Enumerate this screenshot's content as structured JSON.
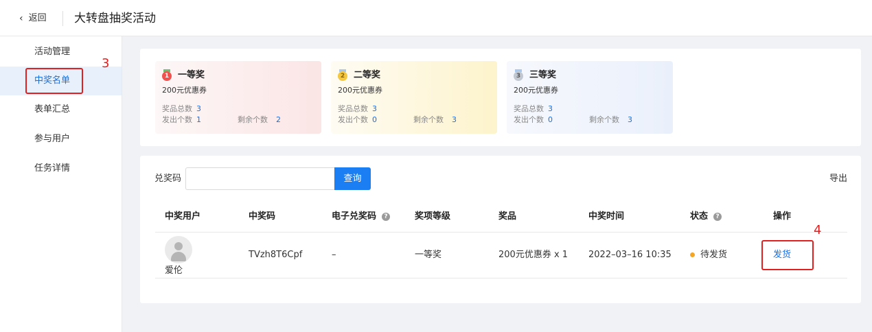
{
  "header": {
    "back_label": "返回",
    "title": "大转盘抽奖活动"
  },
  "sidebar": {
    "items": [
      {
        "label": "活动管理",
        "active": false
      },
      {
        "label": "中奖名单",
        "active": true
      },
      {
        "label": "表单汇总",
        "active": false
      },
      {
        "label": "参与用户",
        "active": false
      },
      {
        "label": "任务详情",
        "active": false
      }
    ]
  },
  "annotations": {
    "step_sidebar": "3",
    "step_action": "4"
  },
  "prizes": [
    {
      "rank": "1",
      "name": "一等奖",
      "desc": "200元优惠券",
      "total_label": "奖品总数",
      "total": "3",
      "issued_label": "发出个数",
      "issued": "1",
      "remaining_label": "剩余个数",
      "remaining": "2"
    },
    {
      "rank": "2",
      "name": "二等奖",
      "desc": "200元优惠券",
      "total_label": "奖品总数",
      "total": "3",
      "issued_label": "发出个数",
      "issued": "0",
      "remaining_label": "剩余个数",
      "remaining": "3"
    },
    {
      "rank": "3",
      "name": "三等奖",
      "desc": "200元优惠券",
      "total_label": "奖品总数",
      "total": "3",
      "issued_label": "发出个数",
      "issued": "0",
      "remaining_label": "剩余个数",
      "remaining": "3"
    }
  ],
  "colors": {
    "accent": "#1b7ef2",
    "link": "#1b6fe0",
    "highlight": "#e02020",
    "pending": "#f5a623"
  },
  "search": {
    "label": "兑奖码",
    "value": "",
    "placeholder": "",
    "button": "查询"
  },
  "export_label": "导出",
  "table": {
    "columns": [
      "中奖用户",
      "中奖码",
      "电子兑奖码",
      "奖项等级",
      "奖品",
      "中奖时间",
      "状态",
      "操作"
    ],
    "help_icon": "?",
    "rows": [
      {
        "user": "爱伦",
        "code": "TVzh8T6Cpf",
        "e_code": "–",
        "level": "一等奖",
        "prize": "200元优惠券 x 1",
        "time": "2022–03–16 10:35",
        "status": "待发货",
        "action": "发货"
      }
    ]
  }
}
